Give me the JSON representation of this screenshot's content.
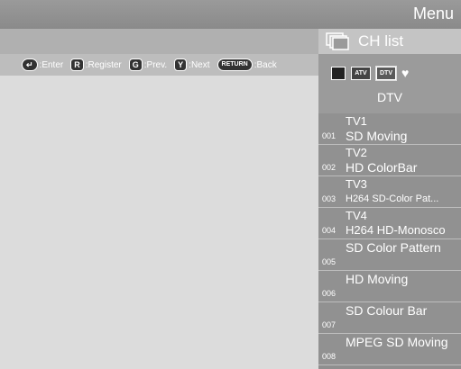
{
  "header": {
    "title": "Menu"
  },
  "chlist": {
    "title": "CH list"
  },
  "help": [
    {
      "key": "↵",
      "label": ":Enter"
    },
    {
      "key": "R",
      "label": ":Register"
    },
    {
      "key": "G",
      "label": ":Prev."
    },
    {
      "key": "Y",
      "label": ":Next"
    },
    {
      "key": "RETURN",
      "label": ":Back"
    }
  ],
  "sources": {
    "icons": [
      "",
      "ATV",
      "DTV"
    ],
    "selected": "DTV",
    "heart_icon": "heart-icon"
  },
  "channels": [
    {
      "num": "001",
      "name": "TV1",
      "program": "SD Moving"
    },
    {
      "num": "002",
      "name": "TV2",
      "program": "HD ColorBar"
    },
    {
      "num": "003",
      "name": "TV3",
      "program": "H264 SD-Color Pat..."
    },
    {
      "num": "004",
      "name": "TV4",
      "program": "H264 HD-Monosco"
    },
    {
      "num": "005",
      "name": "SD Color Pattern",
      "program": ""
    },
    {
      "num": "006",
      "name": "HD Moving",
      "program": ""
    },
    {
      "num": "007",
      "name": "SD Colour Bar",
      "program": ""
    },
    {
      "num": "008",
      "name": "MPEG SD Moving",
      "program": ""
    }
  ]
}
